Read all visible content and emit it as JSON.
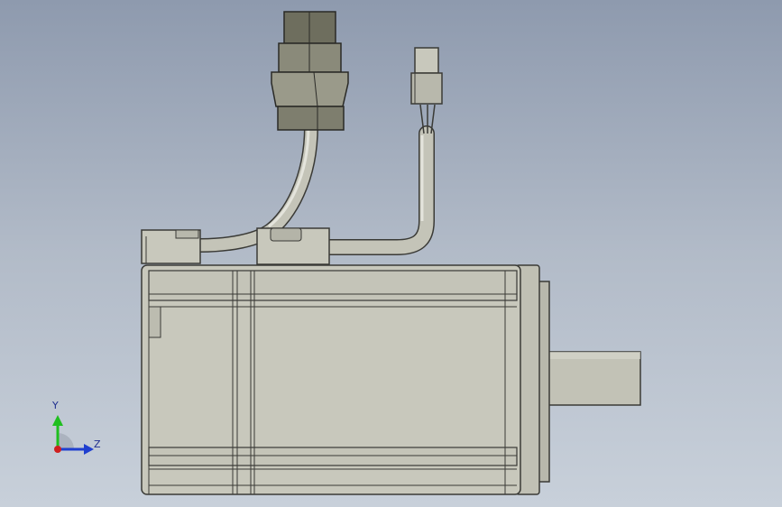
{
  "viewport": {
    "background_top": "#8e9aae",
    "background_bottom": "#c8d0da"
  },
  "model": {
    "body_color": "#c8c8bc",
    "edge_color": "#3a3a36",
    "connector_color": "#9a9a8a",
    "connector_dark": "#6e6e5e"
  },
  "triad": {
    "y_label": "Y",
    "z_label": "Z",
    "y_color": "#1fbf1f",
    "z_color": "#1f3fcf",
    "origin_color": "#cf1f1f"
  }
}
